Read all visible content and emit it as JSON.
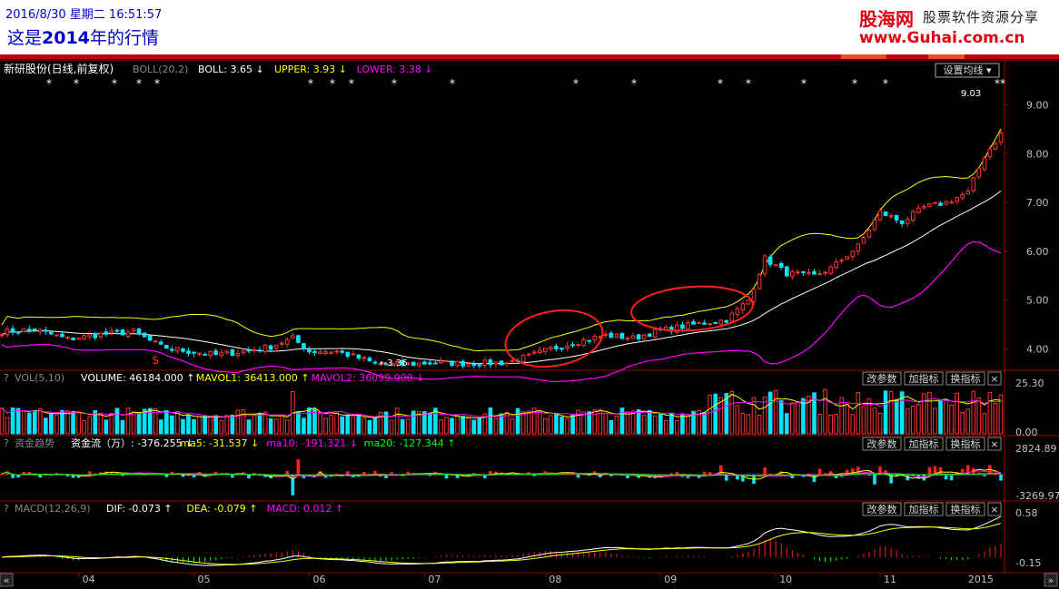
{
  "header": {
    "datetime": "2016/8/30 星期二 16:51:57",
    "title_pre": "这是",
    "title_year": "2014",
    "title_post": "年的行情",
    "logo_name": "股海网",
    "logo_slogan": "股票软件资源分享",
    "logo_url": "www.Guhai.com.cn"
  },
  "chart_data": {
    "type": "candlestick",
    "stock_name": "新研股份",
    "period_label": "(日线,前复权)",
    "settings_button": "设置均线",
    "x_month_labels": [
      {
        "label": "04",
        "x": 14
      },
      {
        "label": "05",
        "x": 35
      },
      {
        "label": "06",
        "x": 56
      },
      {
        "label": "07",
        "x": 77
      },
      {
        "label": "08",
        "x": 99
      },
      {
        "label": "09",
        "x": 120
      },
      {
        "label": "10",
        "x": 141
      },
      {
        "label": "11",
        "x": 160
      },
      {
        "label": "2015",
        "x": 180
      }
    ],
    "x_range": [
      0,
      182
    ],
    "price_panel": {
      "indicator": "BOLL(20,2)",
      "legend": [
        {
          "text": "BOLL: 3.65",
          "arrow": "↓",
          "color": "#ffffff"
        },
        {
          "text": "UPPER: 3.93",
          "arrow": "↓",
          "color": "#ffff00"
        },
        {
          "text": "LOWER: 3.38",
          "arrow": "↓",
          "color": "#ff00ff"
        }
      ],
      "ylim": [
        3.6,
        9.25
      ],
      "y_ticks": [
        "9.00",
        "8.00",
        "7.00",
        "6.00",
        "5.00",
        "4.00"
      ],
      "high_label": "9.03",
      "low_label": "3.36",
      "close_key_points": [
        [
          0,
          4.35
        ],
        [
          6,
          4.4
        ],
        [
          12,
          4.2
        ],
        [
          18,
          4.3
        ],
        [
          24,
          4.35
        ],
        [
          29,
          4.05
        ],
        [
          34,
          3.95
        ],
        [
          39,
          3.88
        ],
        [
          44,
          3.95
        ],
        [
          49,
          4.05
        ],
        [
          53,
          4.22
        ],
        [
          56,
          3.95
        ],
        [
          61,
          3.95
        ],
        [
          65,
          3.82
        ],
        [
          68,
          3.7
        ],
        [
          73,
          3.68
        ],
        [
          79,
          3.72
        ],
        [
          85,
          3.7
        ],
        [
          92,
          3.72
        ],
        [
          96,
          3.85
        ],
        [
          100,
          4.0
        ],
        [
          105,
          4.15
        ],
        [
          110,
          4.28
        ],
        [
          115,
          4.22
        ],
        [
          120,
          4.38
        ],
        [
          126,
          4.5
        ],
        [
          132,
          4.6
        ],
        [
          136,
          5.0
        ],
        [
          139,
          5.85
        ],
        [
          143,
          5.55
        ],
        [
          148,
          5.5
        ],
        [
          151,
          5.65
        ],
        [
          156,
          6.1
        ],
        [
          160,
          6.8
        ],
        [
          164,
          6.6
        ],
        [
          168,
          6.9
        ],
        [
          172,
          7.0
        ],
        [
          176,
          7.2
        ],
        [
          179,
          7.95
        ],
        [
          182,
          8.4
        ]
      ],
      "star_markers": [
        "*",
        "*",
        "*",
        "*",
        "*",
        "*",
        "*",
        "*",
        "*",
        "*",
        "*",
        "*",
        "*",
        "*",
        "*",
        "*",
        "*",
        "*",
        "*"
      ]
    },
    "volume_panel": {
      "indicator": "VOL(5,10)",
      "legend": [
        {
          "text": "VOLUME: 46184.000",
          "arrow": "↑",
          "color": "#ffffff"
        },
        {
          "text": "MAVOL1: 36413.000",
          "arrow": "↑",
          "color": "#ffff00"
        },
        {
          "text": "MAVOL2: 36099.900",
          "arrow": "↓",
          "color": "#ff00ff"
        }
      ],
      "y_ticks": [
        "25.30",
        "0.00"
      ],
      "buttons": [
        "改参数",
        "加指标",
        "换指标",
        "×"
      ]
    },
    "fund_panel": {
      "indicator": "资金趋势",
      "legend": [
        {
          "text": "资金流（万）: -376.255",
          "arrow": "↓",
          "color": "#ffffff"
        },
        {
          "text": "ma5: -31.537",
          "arrow": "↓",
          "color": "#ffff00"
        },
        {
          "text": "ma10: -191.321",
          "arrow": "↓",
          "color": "#ff00ff"
        },
        {
          "text": "ma20: -127.344",
          "arrow": "↑",
          "color": "#00ff00"
        }
      ],
      "y_ticks": [
        "2824.89",
        "-3269.97"
      ],
      "buttons": [
        "改参数",
        "加指标",
        "换指标",
        "×"
      ]
    },
    "macd_panel": {
      "indicator": "MACD(12,26,9)",
      "legend": [
        {
          "text": "DIF: -0.073",
          "arrow": "↑",
          "color": "#ffffff"
        },
        {
          "text": "DEA: -0.079",
          "arrow": "↑",
          "color": "#ffff00"
        },
        {
          "text": "MACD: 0.012",
          "arrow": "↑",
          "color": "#ff00ff"
        }
      ],
      "y_ticks": [
        "0.58",
        "-0.15"
      ],
      "buttons": [
        "改参数",
        "加指标",
        "换指标",
        "×"
      ]
    },
    "nav_buttons": [
      "«",
      "»"
    ]
  },
  "colors": {
    "up": "#ff3232",
    "down": "#00e4ff",
    "axis": "#a00000",
    "text": "#c0c0c0",
    "upper": "#ffff00",
    "mid": "#ffffff",
    "lower": "#ff00ff"
  }
}
